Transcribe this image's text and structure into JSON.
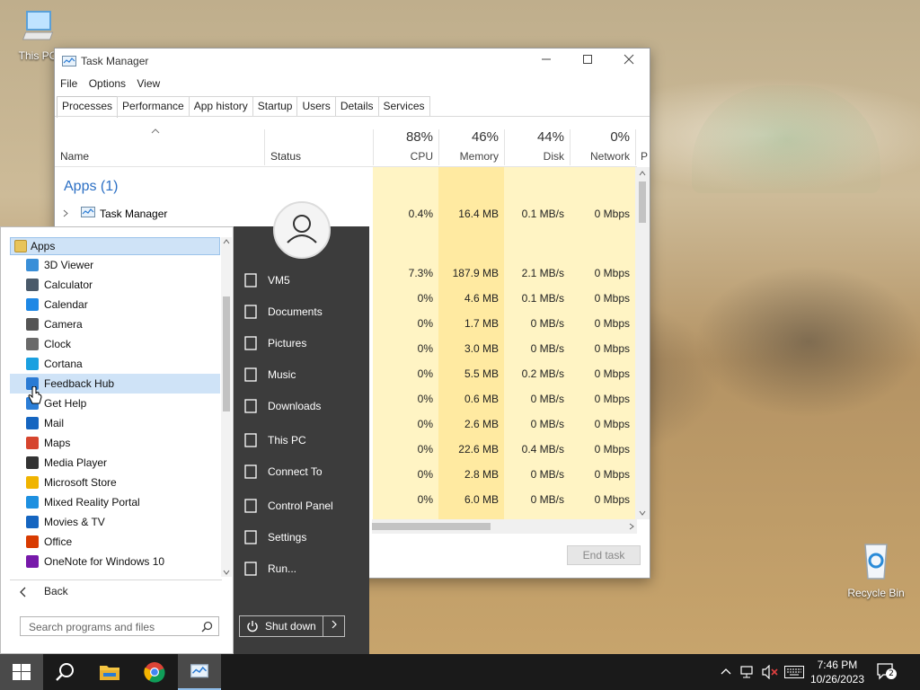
{
  "desktop": {
    "icons": [
      {
        "label": "This PC",
        "icon": "computer-icon"
      },
      {
        "label": "Recycle Bin",
        "icon": "recycle-bin-icon"
      }
    ]
  },
  "task_manager": {
    "title": "Task Manager",
    "menu": [
      "File",
      "Options",
      "View"
    ],
    "tabs": [
      "Processes",
      "Performance",
      "App history",
      "Startup",
      "Users",
      "Details",
      "Services"
    ],
    "active_tab": "Processes",
    "columns": {
      "name": "Name",
      "status": "Status",
      "cpu": {
        "percent": "88%",
        "label": "CPU"
      },
      "memory": {
        "percent": "46%",
        "label": "Memory"
      },
      "disk": {
        "percent": "44%",
        "label": "Disk"
      },
      "network": {
        "percent": "0%",
        "label": "Network"
      },
      "power": "P"
    },
    "group": "Apps (1)",
    "process": {
      "name": "Task Manager",
      "cpu": "0.4%",
      "memory": "16.4 MB",
      "disk": "0.1 MB/s",
      "network": "0 Mbps"
    },
    "rows": [
      {
        "cpu": "7.3%",
        "memory": "187.9 MB",
        "disk": "2.1 MB/s",
        "network": "0 Mbps"
      },
      {
        "cpu": "0%",
        "memory": "4.6 MB",
        "disk": "0.1 MB/s",
        "network": "0 Mbps"
      },
      {
        "cpu": "0%",
        "memory": "1.7 MB",
        "disk": "0 MB/s",
        "network": "0 Mbps"
      },
      {
        "cpu": "0%",
        "memory": "3.0 MB",
        "disk": "0 MB/s",
        "network": "0 Mbps"
      },
      {
        "cpu": "0%",
        "memory": "5.5 MB",
        "disk": "0.2 MB/s",
        "network": "0 Mbps"
      },
      {
        "cpu": "0%",
        "memory": "0.6 MB",
        "disk": "0 MB/s",
        "network": "0 Mbps"
      },
      {
        "cpu": "0%",
        "memory": "2.6 MB",
        "disk": "0 MB/s",
        "network": "0 Mbps"
      },
      {
        "cpu": "0%",
        "memory": "22.6 MB",
        "disk": "0.4 MB/s",
        "network": "0 Mbps"
      },
      {
        "cpu": "0%",
        "memory": "2.8 MB",
        "disk": "0 MB/s",
        "network": "0 Mbps"
      },
      {
        "cpu": "0%",
        "memory": "6.0 MB",
        "disk": "0 MB/s",
        "network": "0 Mbps"
      }
    ],
    "end_task": "End task"
  },
  "start_menu": {
    "apps_header": "Apps",
    "apps": [
      {
        "label": "3D Viewer",
        "color": "#3a8fd8"
      },
      {
        "label": "Calculator",
        "color": "#4a5a6a"
      },
      {
        "label": "Calendar",
        "color": "#1e88e5"
      },
      {
        "label": "Camera",
        "color": "#555555"
      },
      {
        "label": "Clock",
        "color": "#6a6a6a"
      },
      {
        "label": "Cortana",
        "color": "#1aa0e0"
      },
      {
        "label": "Feedback Hub",
        "color": "#2a7bd4"
      },
      {
        "label": "Get Help",
        "color": "#2c7ed6"
      },
      {
        "label": "Mail",
        "color": "#1565c0"
      },
      {
        "label": "Maps",
        "color": "#d6452e"
      },
      {
        "label": "Media Player",
        "color": "#333333"
      },
      {
        "label": "Microsoft Store",
        "color": "#f0b400"
      },
      {
        "label": "Mixed Reality Portal",
        "color": "#1e90e0"
      },
      {
        "label": "Movies & TV",
        "color": "#1565c0"
      },
      {
        "label": "Office",
        "color": "#d83b01"
      },
      {
        "label": "OneNote for Windows 10",
        "color": "#7719aa"
      }
    ],
    "hovered_app": "Feedback Hub",
    "back": "Back",
    "search_placeholder": "Search programs and files",
    "links": [
      {
        "label": "VM5",
        "icon": "user-folder-icon"
      },
      {
        "label": "Documents",
        "icon": "documents-icon"
      },
      {
        "label": "Pictures",
        "icon": "pictures-icon"
      },
      {
        "label": "Music",
        "icon": "music-icon"
      },
      {
        "label": "Downloads",
        "icon": "downloads-icon"
      },
      {
        "label": "This PC",
        "icon": "computer-icon"
      },
      {
        "label": "Connect To",
        "icon": "connect-icon"
      },
      {
        "label": "Control Panel",
        "icon": "control-panel-icon"
      },
      {
        "label": "Settings",
        "icon": "gear-icon"
      },
      {
        "label": "Run...",
        "icon": "run-icon"
      }
    ],
    "shutdown": "Shut down"
  },
  "taskbar": {
    "time": "7:46 PM",
    "date": "10/26/2023",
    "notification_count": "2"
  }
}
